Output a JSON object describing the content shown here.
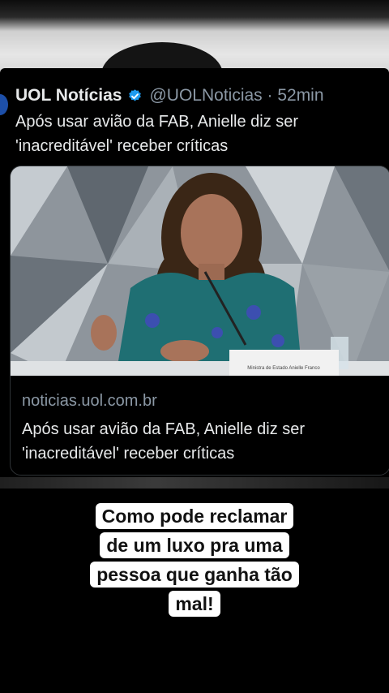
{
  "tweet": {
    "author": "UOL Notícias",
    "handle_time": "@UOLNoticias · 52min",
    "text": "Após usar avião da FAB, Anielle diz ser 'inacreditável' receber críticas",
    "link_card": {
      "domain": "noticias.uol.com.br",
      "title": "Após usar avião da FAB, Anielle diz ser 'inacreditável' receber críticas",
      "nameplate": "Ministra de Estado Anielle Franco"
    }
  },
  "caption": "Como pode reclamar\nde um luxo pra uma\npessoa que ganha tão\nmal!",
  "colors": {
    "verified_badge": "#1d9bf0",
    "text_primary": "#e7e9ea",
    "text_secondary": "#8b98a5",
    "caption_bg": "#ffffff"
  },
  "icons": [
    "verified-badge-icon"
  ]
}
